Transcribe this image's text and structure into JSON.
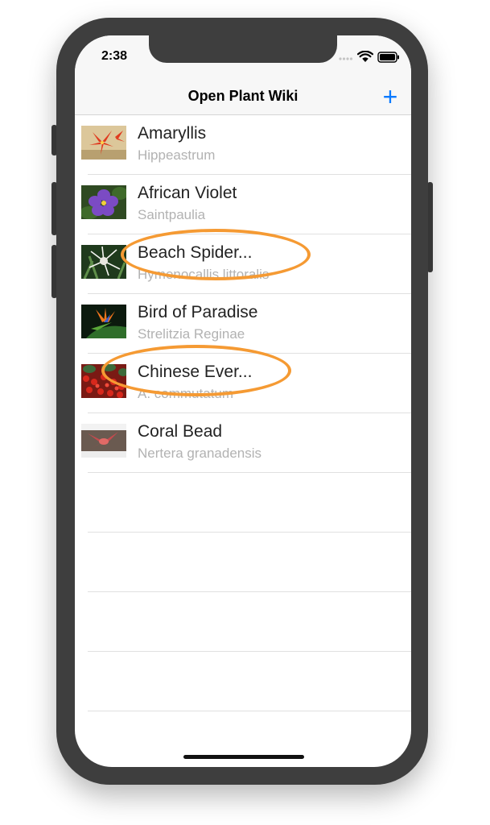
{
  "status_bar": {
    "time": "2:38"
  },
  "nav": {
    "title": "Open Plant Wiki",
    "add_label": "+"
  },
  "plants": [
    {
      "name": "Amaryllis",
      "scientific": "Hippeastrum"
    },
    {
      "name": "African Violet",
      "scientific": "Saintpaulia"
    },
    {
      "name": "Beach Spider...",
      "scientific": "Hymenocallis littoralis"
    },
    {
      "name": "Bird of Paradise",
      "scientific": "Strelitzia Reginae"
    },
    {
      "name": "Chinese Ever...",
      "scientific": "A. commutatum"
    },
    {
      "name": "Coral Bead",
      "scientific": "Nertera granadensis"
    }
  ],
  "colors": {
    "accent": "#0a7aff",
    "annotation": "#f59a33",
    "frame": "#3e3e3e"
  },
  "icons": [
    "cellular-signal-icon",
    "wifi-icon",
    "battery-icon",
    "plus-icon"
  ]
}
